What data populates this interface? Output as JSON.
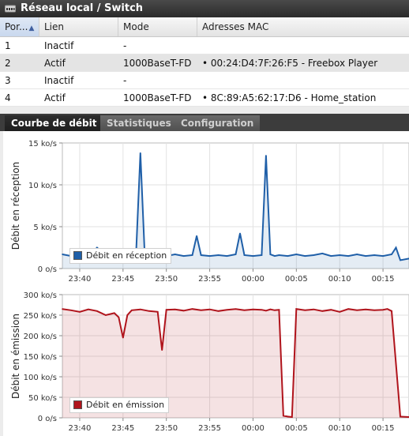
{
  "window": {
    "title": "Réseau local / Switch",
    "icon": "switch-icon"
  },
  "table": {
    "headers": {
      "port": "Por...",
      "link": "Lien",
      "mode": "Mode",
      "mac": "Adresses MAC"
    },
    "rows": [
      {
        "port": "1",
        "link": "Inactif",
        "mode": "-",
        "mac": ""
      },
      {
        "port": "2",
        "link": "Actif",
        "mode": "1000BaseT-FD",
        "mac": "• 00:24:D4:7F:26:F5 - Freebox Player"
      },
      {
        "port": "3",
        "link": "Inactif",
        "mode": "-",
        "mac": ""
      },
      {
        "port": "4",
        "link": "Actif",
        "mode": "1000BaseT-FD",
        "mac": "• 8C:89:A5:62:17:D6 - Home_station"
      }
    ]
  },
  "tabs": {
    "rate_curve": "Courbe de débit",
    "statistics": "Statistiques",
    "configuration": "Configuration"
  },
  "chart_data": [
    {
      "type": "area",
      "title": "",
      "xlabel": "",
      "ylabel": "Débit en réception",
      "ylim": [
        0,
        15
      ],
      "yticks": [
        "0 o/s",
        "5 ko/s",
        "10 ko/s",
        "15 ko/s"
      ],
      "xticks": [
        "23:40",
        "23:45",
        "23:50",
        "23:55",
        "00:00",
        "00:05",
        "00:10",
        "00:15"
      ],
      "x_range": [
        "23:38",
        "00:18"
      ],
      "grid": true,
      "legend_position": "bottom-left",
      "color": "#1f5fa8",
      "series": [
        {
          "name": "Débit en réception",
          "x": [
            "23:38",
            "23:39",
            "23:40",
            "23:41",
            "23:42",
            "23:43",
            "23:44",
            "23:45",
            "23:46",
            "23:46:30",
            "23:47",
            "23:47:30",
            "23:48",
            "23:49",
            "23:50",
            "23:51",
            "23:52",
            "23:53",
            "23:53:30",
            "23:54",
            "23:55",
            "23:56",
            "23:57",
            "23:58",
            "23:58:30",
            "23:59",
            "00:00",
            "00:01",
            "00:01:30",
            "00:02",
            "00:02:30",
            "00:03",
            "00:04",
            "00:05",
            "00:06",
            "00:07",
            "00:08",
            "00:09",
            "00:10",
            "00:11",
            "00:12",
            "00:13",
            "00:14",
            "00:15",
            "00:16",
            "00:16:30",
            "00:17",
            "00:18"
          ],
          "values": [
            1.7,
            1.5,
            1.8,
            1.4,
            2.5,
            1.6,
            1.5,
            1.6,
            1.5,
            1.7,
            13.8,
            1.6,
            1.5,
            1.6,
            1.5,
            1.7,
            1.5,
            1.6,
            3.9,
            1.6,
            1.5,
            1.6,
            1.5,
            1.7,
            4.2,
            1.6,
            1.5,
            1.6,
            13.5,
            1.7,
            1.5,
            1.6,
            1.5,
            1.7,
            1.5,
            1.6,
            1.8,
            1.5,
            1.6,
            1.5,
            1.7,
            1.5,
            1.6,
            1.5,
            1.7,
            2.5,
            1.0,
            1.2
          ]
        }
      ]
    },
    {
      "type": "area",
      "title": "",
      "xlabel": "",
      "ylabel": "Débit en émission",
      "ylim": [
        0,
        300
      ],
      "yticks": [
        "0 o/s",
        "50 ko/s",
        "100 ko/s",
        "150 ko/s",
        "200 ko/s",
        "250 ko/s",
        "300 ko/s"
      ],
      "xticks": [
        "23:40",
        "23:45",
        "23:50",
        "23:55",
        "00:00",
        "00:05",
        "00:10",
        "00:15"
      ],
      "x_range": [
        "23:38",
        "00:18"
      ],
      "grid": true,
      "legend_position": "bottom-left",
      "color": "#b0141c",
      "series": [
        {
          "name": "Débit en émission",
          "x": [
            "23:38",
            "23:39",
            "23:40",
            "23:41",
            "23:42",
            "23:43",
            "23:44",
            "23:44:30",
            "23:45",
            "23:45:30",
            "23:46",
            "23:47",
            "23:48",
            "23:49",
            "23:49:30",
            "23:50",
            "23:51",
            "23:52",
            "23:53",
            "23:54",
            "23:55",
            "23:56",
            "23:57",
            "23:58",
            "23:59",
            "00:00",
            "00:01",
            "00:01:30",
            "00:02",
            "00:02:30",
            "00:03",
            "00:03:30",
            "00:04",
            "00:04:30",
            "00:05",
            "00:06",
            "00:07",
            "00:08",
            "00:09",
            "00:10",
            "00:11",
            "00:12",
            "00:13",
            "00:14",
            "00:15",
            "00:15:30",
            "00:16",
            "00:17",
            "00:18"
          ],
          "values": [
            265,
            262,
            258,
            264,
            260,
            250,
            255,
            245,
            195,
            250,
            262,
            264,
            260,
            258,
            165,
            263,
            264,
            261,
            265,
            262,
            264,
            260,
            263,
            265,
            262,
            264,
            263,
            261,
            264,
            262,
            263,
            5,
            3,
            2,
            265,
            262,
            264,
            260,
            263,
            258,
            265,
            262,
            264,
            262,
            263,
            265,
            260,
            3,
            2
          ]
        }
      ]
    }
  ]
}
